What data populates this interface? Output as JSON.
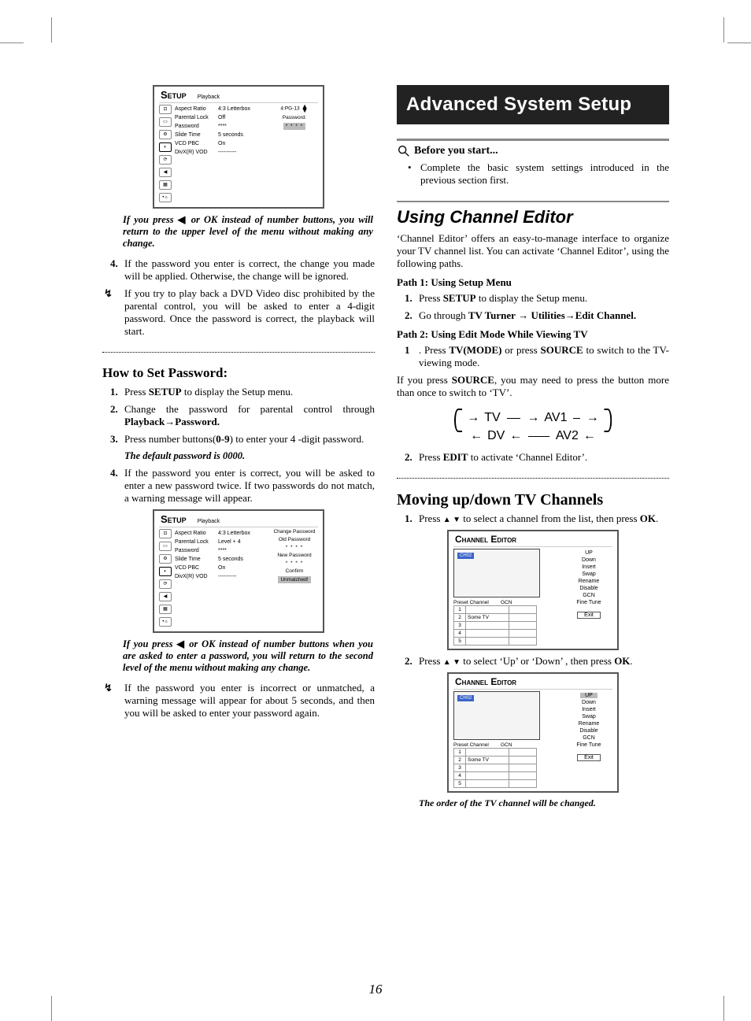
{
  "page_number": "16",
  "left": {
    "setup_panel_1": {
      "title": "Setup",
      "subtitle": "Playback",
      "icons": [
        "☼",
        "▭",
        "⚙",
        "◐",
        "⟳",
        "◀⊟",
        "▦",
        "•☼"
      ],
      "rows": [
        {
          "label": "Aspect Ratio",
          "value": "4:3 Letterbox"
        },
        {
          "label": "Parental Lock",
          "value": "Off"
        },
        {
          "label": "Password",
          "value": "****"
        },
        {
          "label": "Slide Time",
          "value": "5 seconds"
        },
        {
          "label": "VCD PBC",
          "value": "On"
        },
        {
          "label": "DivX(R) VOD",
          "value": "----------"
        }
      ],
      "right": {
        "top": "4:PG-13",
        "pw_label": "Password:",
        "pw_value": "* * * *"
      }
    },
    "note1_prefix": "If you press ",
    "note1_mid": " or ",
    "note1_ok": "OK",
    "note1_suffix": " instead of number buttons, you will return to the upper level of the menu without making any change.",
    "item4": "If the password you enter is correct, the change you made will be applied. Otherwise, the change will be ignored.",
    "tip1": "If you try to play back a DVD Video disc prohibited by the parental control, you will be asked to enter a 4-digit password. Once the password is correct, the playback will start.",
    "howto_heading": "How to Set Password:",
    "step1_pre": "Press ",
    "step1_b": "SETUP",
    "step1_post": " to display the Setup menu.",
    "step2_pre": "Change the password for parental control through ",
    "step2_b": "Playback→Password.",
    "step3_pre": "Press number buttons(",
    "step3_b": "0-9",
    "step3_post": ") to enter your 4 -digit password.",
    "default_note": "The default password is 0000.",
    "step4": "If the password you enter is correct, you will be asked to enter a new password twice. If two passwords do not match, a warning message will appear.",
    "setup_panel_2": {
      "title": "Setup",
      "subtitle": "Playback",
      "rows": [
        {
          "label": "Aspect Ratio",
          "value": "4:3 Letterbox"
        },
        {
          "label": "Parental Lock",
          "value": "Level + 4"
        },
        {
          "label": "Password",
          "value": "****"
        },
        {
          "label": "Slide Time",
          "value": "5 seconds"
        },
        {
          "label": "VCD PBC",
          "value": "On"
        },
        {
          "label": "DivX(R) VOD",
          "value": "----------"
        }
      ],
      "right": {
        "change": "Change Password",
        "oldpw": "Old Password",
        "old_val": "* * * *",
        "newpw": "New Password",
        "new_val": "* * * *",
        "confirm": "Confirm",
        "unmatched": "Unmatched!"
      }
    },
    "note2_prefix": "If you press ",
    "note2_ok": "OK",
    "note2_suffix": " instead of number buttons when you are asked to enter a password, you will return to the second level of the menu without making any change.",
    "tip2": "If the password you enter is incorrect or unmatched, a warning message will appear for about 5 seconds, and then you will be asked to enter your password again."
  },
  "right": {
    "banner": "Advanced System Setup",
    "before": "Before you start...",
    "before_bullet": "Complete the basic system settings introduced in the previous section first.",
    "using_ce": "Using Channel Editor",
    "ce_intro": "‘Channel Editor’ offers an easy-to-manage interface to organize your TV channel list. You can activate ‘Channel Editor’, using the following paths.",
    "path1_h": "Path 1: Using Setup Menu",
    "p1_s1_pre": "Press ",
    "p1_s1_b": "SETUP",
    "p1_s1_post": " to display the Setup menu.",
    "p1_s2_pre": "Go through ",
    "p1_s2_b1": "TV Turner",
    "p1_s2_arrow": " → ",
    "p1_s2_b2": "Utilities",
    "p1_s2_b3": "Edit Channel.",
    "path2_h": "Path 2: Using Edit Mode While Viewing TV",
    "p2_s1_pre": ". Press ",
    "p2_s1_b1": "TV(MODE)",
    "p2_s1_mid": " or press ",
    "p2_s1_b2": "SOURCE",
    "p2_s1_post": " to switch to the TV-viewing mode.",
    "p2_note_pre": "If you press ",
    "p2_note_b": "SOURCE",
    "p2_note_post": ", you may need to press the button more than once to switch to ‘TV’.",
    "cycle": {
      "a": "TV",
      "b": "AV1",
      "c": "DV",
      "d": "AV2"
    },
    "p2_s2_pre": "Press ",
    "p2_s2_b": "EDIT",
    "p2_s2_post": " to activate ‘Channel Editor’.",
    "moving_h": "Moving up/down TV Channels",
    "mv_s1_pre": "Press  ",
    "mv_s1_post": "  to select a channel from the list, then press ",
    "mv_s1_ok": "OK",
    "ce_panel": {
      "title": "Channel Editor",
      "preview_tag": "CH02",
      "preset": "Preset Channel",
      "gcn": "GCN",
      "rows": [
        {
          "n": "1",
          "name": ""
        },
        {
          "n": "2",
          "name": "Some TV"
        },
        {
          "n": "3",
          "name": ""
        },
        {
          "n": "4",
          "name": ""
        },
        {
          "n": "5",
          "name": ""
        }
      ],
      "opts": [
        "UP",
        "Down",
        "Insert",
        "Swap",
        "Rename",
        "Disable",
        "GCN",
        "Fine Tune"
      ],
      "exit": "Exit"
    },
    "mv_s2_pre": "Press  ",
    "mv_s2_post": "  to select ‘Up’ or ‘Down’ , then press ",
    "mv_s2_ok": "OK",
    "order_note": "The order of the TV channel will be changed."
  }
}
